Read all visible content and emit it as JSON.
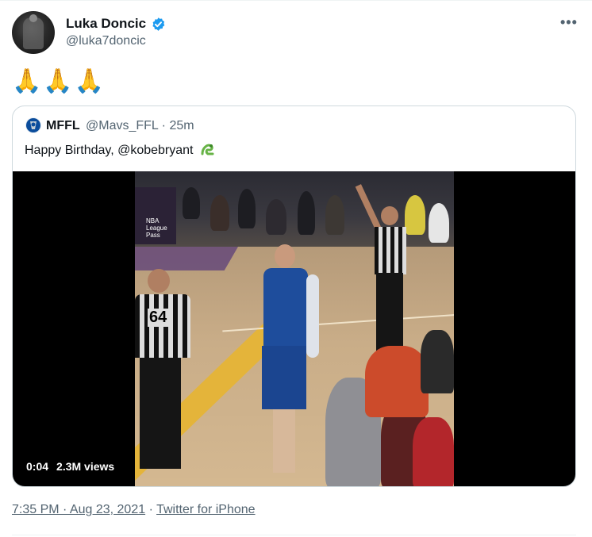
{
  "tweet": {
    "author_name": "Luka Doncic",
    "author_handle": "@luka7doncic",
    "more_label": "•••",
    "text": "🙏🙏🙏",
    "timestamp": "7:35 PM · Aug 23, 2021",
    "separator": " · ",
    "source": "Twitter for iPhone"
  },
  "quoted": {
    "author_name": "MFFL",
    "author_handle": "@Mavs_FFL · 25m",
    "text": "Happy Birthday, @kobebryant",
    "video": {
      "duration": "0:04",
      "views": "2.3M views",
      "jersey_number": "64",
      "sign_text": "NBA League Pass"
    }
  },
  "colors": {
    "verified_blue": "#1d9bf0",
    "secondary_text": "#536471",
    "border": "#cfd9de"
  },
  "icons": [
    "verified-badge-icon",
    "more-options-icon",
    "snake-emoji-icon",
    "mavs-logo-icon"
  ]
}
